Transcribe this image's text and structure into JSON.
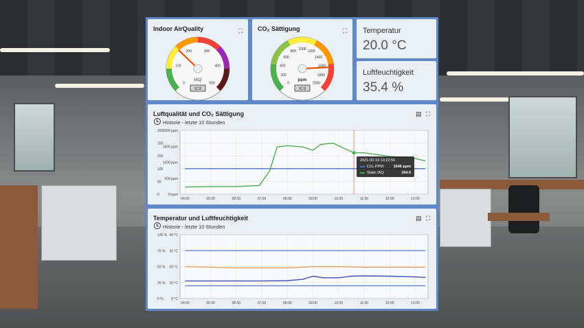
{
  "gauges": [
    {
      "title": "Indoor AirQuality",
      "unit": "IAQ",
      "readout": "IC9",
      "ticks": [
        "0",
        "100",
        "200",
        "300",
        "400",
        "500"
      ],
      "min": 0,
      "max": 500,
      "value": 164.6,
      "bands": [
        "#4caf50",
        "#ffeb3b",
        "#ff9800",
        "#f44336",
        "#9c27b0",
        "#5d1a1a"
      ]
    },
    {
      "title": "CO₂ Sättigung",
      "unit": "ppm",
      "readout": "IC9",
      "ticks": [
        "0",
        "200",
        "400",
        "600",
        "800",
        "1000",
        "1200",
        "1400",
        "1600",
        "1800",
        "2000"
      ],
      "min": 0,
      "max": 2000,
      "value": 1646,
      "bands": [
        "#4caf50",
        "#8bc34a",
        "#ffeb3b",
        "#ff9800",
        "#f44336"
      ]
    }
  ],
  "stats": [
    {
      "label": "Temperatur",
      "value": "20.0 °C"
    },
    {
      "label": "Luftfeuchtigkeit",
      "value": "35.4 %"
    }
  ],
  "chart1": {
    "title": "Luftqualität und CO₂ Sättigung",
    "subtitle": "Historie - letzte 10 Stunden",
    "chart_data": {
      "type": "line",
      "x": [
        "04:00",
        "05:00",
        "06:00",
        "07:00",
        "08:00",
        "09:00",
        "10:00",
        "11:00",
        "12:00",
        "13:00"
      ],
      "y_left_ticks": [
        "0",
        "50",
        "100",
        "150",
        "200",
        "250"
      ],
      "y_right_ticks": [
        "0 ppm",
        "500 ppm",
        "1000 ppm",
        "1500 ppm",
        "2000 ppm"
      ],
      "series": [
        {
          "name": "CO₂ PPM:",
          "color": "#3f6fd1",
          "axis": "right",
          "points": [
            [
              4.0,
              1000
            ],
            [
              5.0,
              1000
            ],
            [
              6.0,
              1000
            ],
            [
              7.0,
              1000
            ],
            [
              8.0,
              1000
            ],
            [
              9.0,
              1000
            ],
            [
              10.0,
              1000
            ],
            [
              11.0,
              1000
            ],
            [
              12.0,
              1000
            ],
            [
              13.0,
              1000
            ],
            [
              13.4,
              1000
            ]
          ]
        },
        {
          "name": "Static IAQ",
          "color": "#4caf50",
          "axis": "left",
          "points": [
            [
              4.0,
              28
            ],
            [
              5.0,
              30
            ],
            [
              6.0,
              30
            ],
            [
              6.9,
              34
            ],
            [
              7.3,
              90
            ],
            [
              7.6,
              185
            ],
            [
              8.0,
              190
            ],
            [
              8.6,
              185
            ],
            [
              9.0,
              172
            ],
            [
              9.3,
              195
            ],
            [
              9.8,
              200
            ],
            [
              10.2,
              180
            ],
            [
              10.6,
              162
            ],
            [
              11.0,
              162
            ],
            [
              12.0,
              148
            ],
            [
              13.0,
              140
            ],
            [
              13.4,
              130
            ]
          ]
        }
      ],
      "cursor_x": 10.6
    },
    "tooltip": {
      "time": "2021-02-19 10:22:56",
      "co2_label": "CO₂ PPM:",
      "co2_value": "1646 ppm",
      "iaq_label": "Static IAQ",
      "iaq_value": "164.6"
    }
  },
  "chart2": {
    "title": "Temperatur und Luftfeuchtigkeit",
    "subtitle": "Historie - letzte 10 Stunden",
    "chart_data": {
      "type": "line",
      "x": [
        "04:00",
        "05:00",
        "06:00",
        "07:00",
        "08:00",
        "09:00",
        "10:00",
        "11:00",
        "12:00",
        "13:00"
      ],
      "y_left_ticks": [
        "0 %",
        "25 %",
        "50 %",
        "75 %",
        "100 %"
      ],
      "y_right_ticks": [
        "0 °C",
        "10 °C",
        "20 °C",
        "30 °C",
        "40 °C"
      ],
      "series": [
        {
          "name": "Luftfeuchtigkeit",
          "color": "#e8a068",
          "axis": "left",
          "points": [
            [
              4.0,
              50
            ],
            [
              5.0,
              49
            ],
            [
              6.0,
              48
            ],
            [
              7.0,
              48
            ],
            [
              8.0,
              48
            ],
            [
              9.0,
              50
            ],
            [
              10.0,
              50
            ],
            [
              11.0,
              49
            ],
            [
              12.0,
              49
            ],
            [
              13.0,
              49
            ],
            [
              13.4,
              49
            ]
          ]
        },
        {
          "name": "Temperatur",
          "color": "#3f51b5",
          "axis": "right",
          "points": [
            [
              4.0,
              11
            ],
            [
              5.0,
              11
            ],
            [
              6.0,
              11
            ],
            [
              7.0,
              11
            ],
            [
              8.0,
              11.2
            ],
            [
              8.6,
              12
            ],
            [
              9.0,
              14
            ],
            [
              9.4,
              13
            ],
            [
              10.0,
              13
            ],
            [
              10.5,
              14
            ],
            [
              11.0,
              14.2
            ],
            [
              12.0,
              14
            ],
            [
              13.0,
              13.5
            ],
            [
              13.4,
              13.2
            ]
          ]
        },
        {
          "name": "",
          "color": "#5b86d6",
          "axis": "left",
          "points": [
            [
              4.0,
              75
            ],
            [
              13.4,
              75
            ]
          ]
        },
        {
          "name": "",
          "color": "#5b86d6",
          "axis": "left",
          "points": [
            [
              4.0,
              20
            ],
            [
              13.4,
              20
            ]
          ]
        }
      ]
    }
  }
}
